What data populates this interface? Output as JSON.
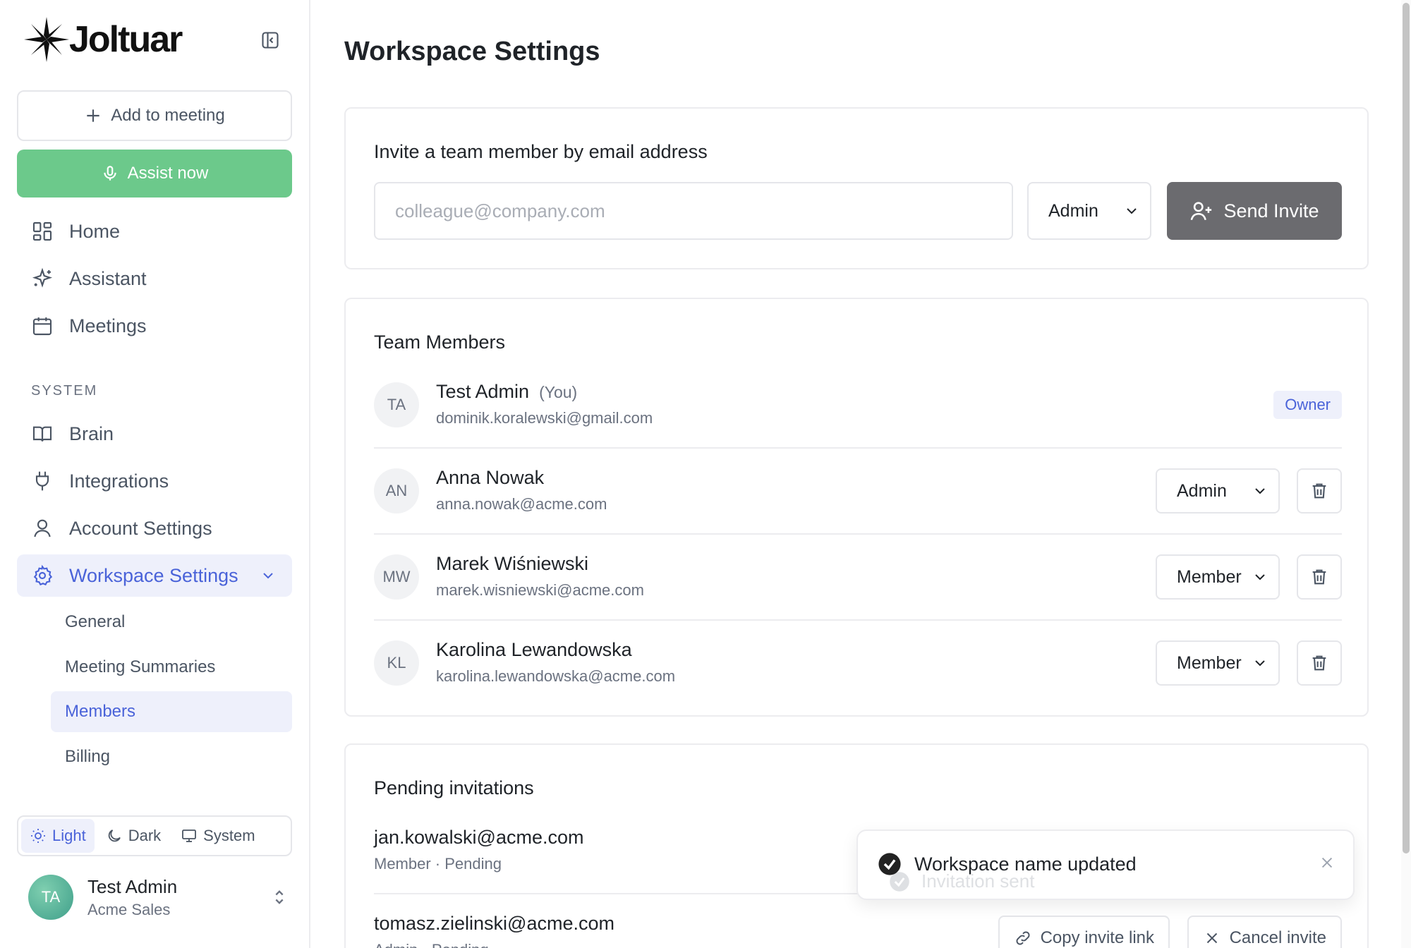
{
  "brand": {
    "name": "Joltuar"
  },
  "sidebar": {
    "add_meeting": "Add to meeting",
    "assist_now": "Assist now",
    "nav": [
      {
        "label": "Home",
        "icon": "grid-icon"
      },
      {
        "label": "Assistant",
        "icon": "sparkle-icon"
      },
      {
        "label": "Meetings",
        "icon": "calendar-icon"
      }
    ],
    "system_label": "SYSTEM",
    "system_nav": [
      {
        "label": "Brain",
        "icon": "book-icon"
      },
      {
        "label": "Integrations",
        "icon": "plug-icon"
      },
      {
        "label": "Account Settings",
        "icon": "user-icon"
      },
      {
        "label": "Workspace Settings",
        "icon": "gear-icon",
        "active": true
      }
    ],
    "sub_nav": [
      {
        "label": "General"
      },
      {
        "label": "Meeting Summaries"
      },
      {
        "label": "Members",
        "active": true
      },
      {
        "label": "Billing"
      }
    ],
    "theme": {
      "light": "Light",
      "dark": "Dark",
      "system": "System",
      "selected": "Light"
    },
    "user": {
      "initials": "TA",
      "name": "Test Admin",
      "org": "Acme Sales"
    }
  },
  "main": {
    "title": "Workspace Settings",
    "invite": {
      "title": "Invite a team member by email address",
      "placeholder": "colleague@company.com",
      "role": "Admin",
      "send_label": "Send Invite"
    },
    "team": {
      "title": "Team Members",
      "members": [
        {
          "initials": "TA",
          "name": "Test Admin",
          "you": "(You)",
          "email": "dominik.koralewski@gmail.com",
          "badge": "Owner"
        },
        {
          "initials": "AN",
          "name": "Anna Nowak",
          "email": "anna.nowak@acme.com",
          "role": "Admin"
        },
        {
          "initials": "MW",
          "name": "Marek Wiśniewski",
          "email": "marek.wisniewski@acme.com",
          "role": "Member"
        },
        {
          "initials": "KL",
          "name": "Karolina Lewandowska",
          "email": "karolina.lewandowska@acme.com",
          "role": "Member"
        }
      ]
    },
    "pending": {
      "title": "Pending invitations",
      "invites": [
        {
          "email": "jan.kowalski@acme.com",
          "meta": "Member · Pending"
        },
        {
          "email": "tomasz.zielinski@acme.com",
          "meta": "Admin · Pending",
          "copy_label": "Copy invite link",
          "cancel_label": "Cancel invite"
        }
      ]
    },
    "toast": {
      "message": "Workspace name updated",
      "ghost_message": "Invitation sent"
    }
  },
  "colors": {
    "accent": "#4a63d9",
    "assist_green": "#6cc98b",
    "send_button": "#6b6b6f"
  }
}
